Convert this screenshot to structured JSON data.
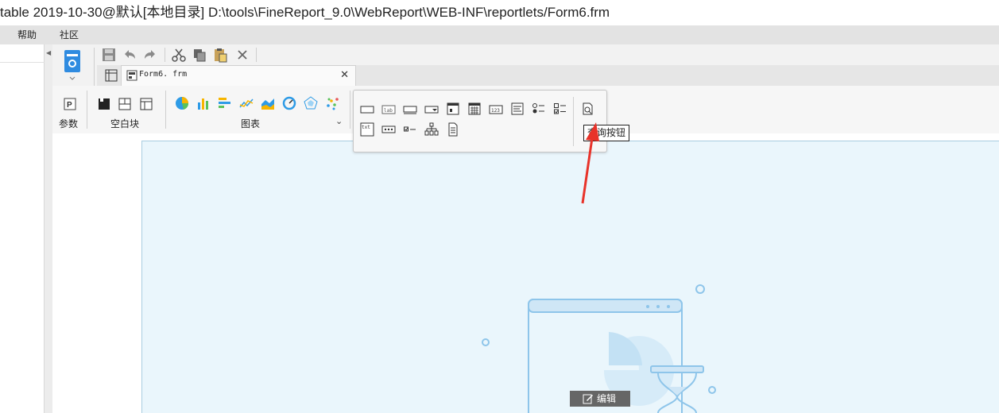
{
  "window": {
    "title": "table 2019-10-30@默认[本地目录]     D:\\tools\\FineReport_9.0\\WebReport\\WEB-INF\\reportlets/Form6.frm"
  },
  "menu": {
    "items": [
      {
        "label": "帮助"
      },
      {
        "label": "社区"
      }
    ]
  },
  "toolbar": {
    "icons": [
      "save-icon",
      "undo-icon",
      "redo-icon",
      "cut-icon",
      "copy-icon",
      "paste-icon",
      "delete-icon"
    ]
  },
  "tabs": [
    {
      "label": "Form6. frm",
      "active": true
    }
  ],
  "ribbon": {
    "groups": [
      {
        "label": "参数"
      },
      {
        "label": "空白块"
      },
      {
        "label": "图表"
      }
    ]
  },
  "popup": {
    "widgets": [
      "text-field-icon",
      "label-icon",
      "button-icon",
      "dropdown-icon",
      "date-icon",
      "calendar-icon",
      "number-field-icon",
      "textarea-icon",
      "radio-group-icon",
      "checkbox-group-icon",
      "search-button-icon",
      "textarea-txt-icon",
      "password-icon",
      "checkbox-icon",
      "tree-icon",
      "file-icon"
    ]
  },
  "tooltip": {
    "text": "查询按钮"
  },
  "edit_button": {
    "label": "编辑"
  },
  "colors": {
    "canvas_bg": "#eaf6fc",
    "arrow": "#e8332a",
    "illustration": "#8ec5ea",
    "menu_bg": "#e3e3e3"
  }
}
